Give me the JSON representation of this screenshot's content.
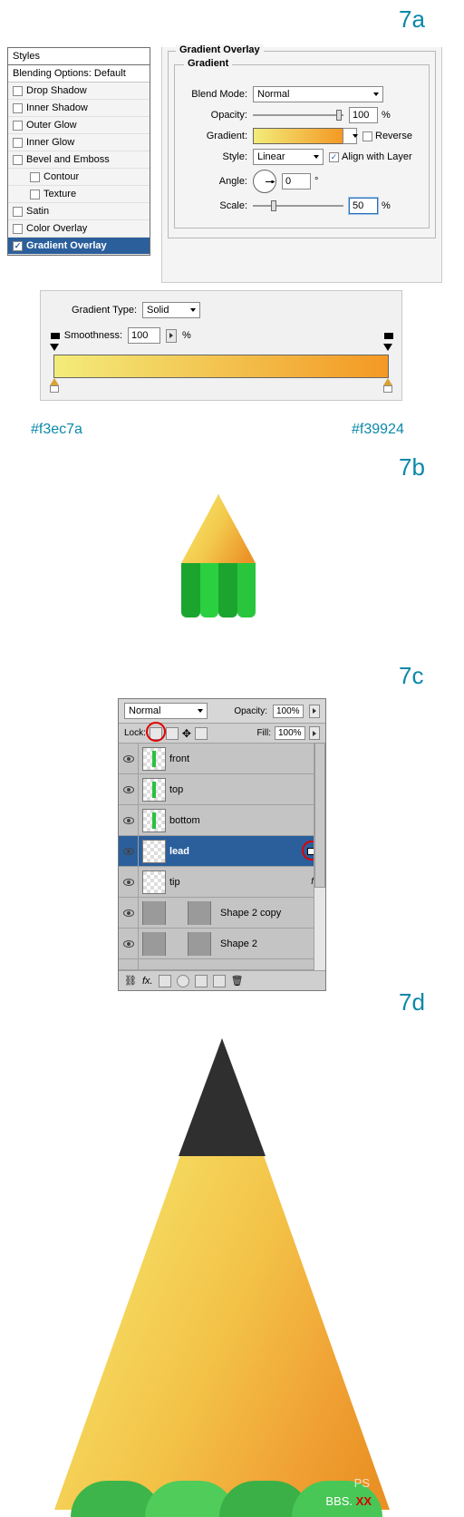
{
  "labels": {
    "s7a": "7a",
    "s7b": "7b",
    "s7c": "7c",
    "s7d": "7d"
  },
  "styles_panel": {
    "title": "Styles",
    "blending": "Blending Options: Default",
    "items": [
      {
        "label": "Drop Shadow",
        "checked": false
      },
      {
        "label": "Inner Shadow",
        "checked": false
      },
      {
        "label": "Outer Glow",
        "checked": false
      },
      {
        "label": "Inner Glow",
        "checked": false
      },
      {
        "label": "Bevel and Emboss",
        "checked": false
      },
      {
        "label": "Contour",
        "checked": false,
        "indent": true
      },
      {
        "label": "Texture",
        "checked": false,
        "indent": true
      },
      {
        "label": "Satin",
        "checked": false
      },
      {
        "label": "Color Overlay",
        "checked": false
      },
      {
        "label": "Gradient Overlay",
        "checked": true
      }
    ]
  },
  "gradient_overlay": {
    "group_title": "Gradient Overlay",
    "sub_title": "Gradient",
    "blend_mode_label": "Blend Mode:",
    "blend_mode_value": "Normal",
    "opacity_label": "Opacity:",
    "opacity_value": "100",
    "pct": "%",
    "gradient_label": "Gradient:",
    "reverse_label": "Reverse",
    "style_label": "Style:",
    "style_value": "Linear",
    "align_label": "Align with Layer",
    "angle_label": "Angle:",
    "angle_value": "0",
    "deg": "°",
    "scale_label": "Scale:",
    "scale_value": "50"
  },
  "gradient_editor": {
    "type_label": "Gradient Type:",
    "type_value": "Solid",
    "smooth_label": "Smoothness:",
    "smooth_value": "100",
    "pct": "%",
    "left_color": "#f3ec7a",
    "right_color": "#f39924"
  },
  "layers_panel": {
    "blend_value": "Normal",
    "opacity_label": "Opacity:",
    "opacity_value": "100%",
    "lock_label": "Lock:",
    "fill_label": "Fill:",
    "fill_value": "100%",
    "layers": [
      {
        "name": "front"
      },
      {
        "name": "top"
      },
      {
        "name": "bottom"
      },
      {
        "name": "lead",
        "selected": true
      },
      {
        "name": "tip",
        "fx": "fx"
      },
      {
        "name": "Shape 2 copy"
      },
      {
        "name": "Shape 2"
      }
    ]
  },
  "footer": {
    "ps": "PS",
    "bbs": "BBS.",
    "xx": "XX"
  }
}
